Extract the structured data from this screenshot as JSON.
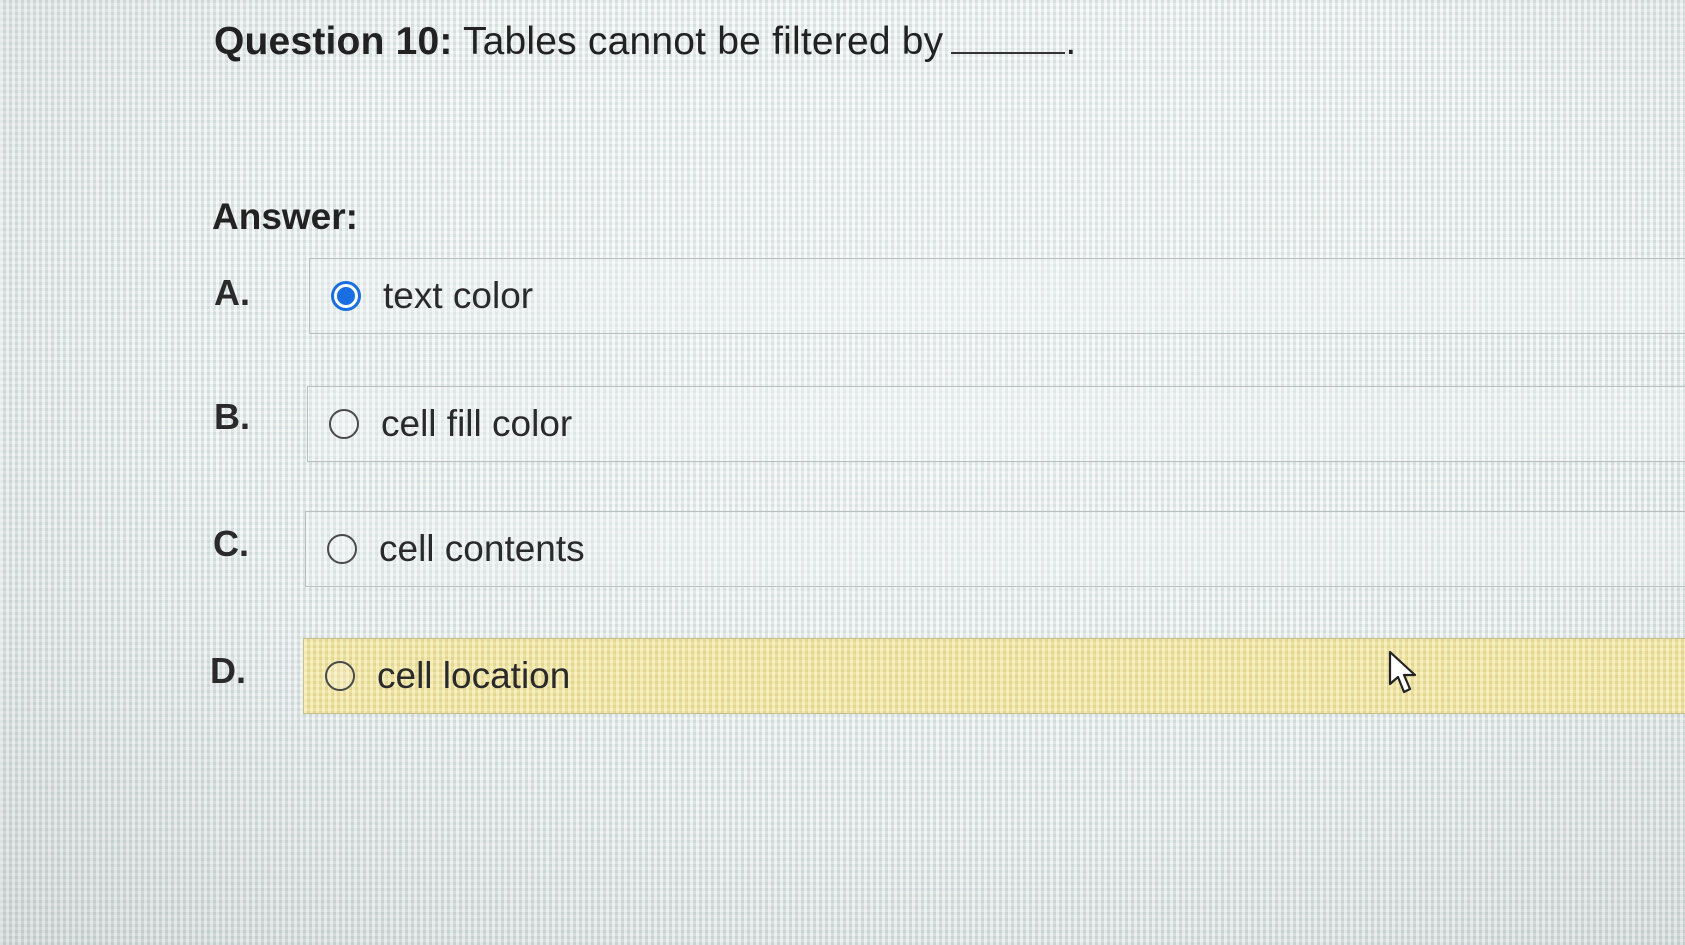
{
  "question": {
    "label": "Question 10:",
    "text": "Tables cannot be filtered by",
    "end": "."
  },
  "answer_label": "Answer:",
  "options": [
    {
      "letter": "A.",
      "text": "text color",
      "selected": true,
      "highlighted": false
    },
    {
      "letter": "B.",
      "text": "cell fill color",
      "selected": false,
      "highlighted": false
    },
    {
      "letter": "C.",
      "text": "cell contents",
      "selected": false,
      "highlighted": false
    },
    {
      "letter": "D.",
      "text": "cell location",
      "selected": false,
      "highlighted": true
    }
  ],
  "colors": {
    "radio_selected": "#1a6fe0",
    "highlight": "#ecde96"
  },
  "icons": {
    "cursor": "arrow-cursor-icon"
  }
}
